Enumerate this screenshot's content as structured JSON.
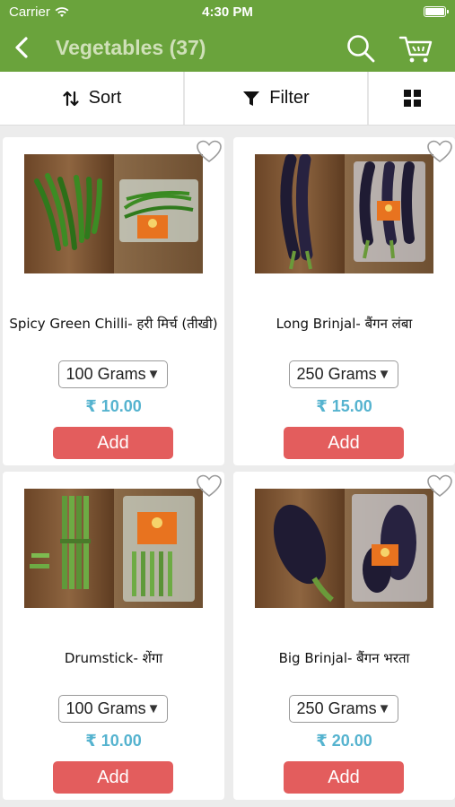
{
  "status_bar": {
    "carrier": "Carrier",
    "time": "4:30 PM"
  },
  "nav": {
    "title": "Vegetables (37)",
    "back_icon": "chevron-left-icon",
    "search_icon": "search-icon",
    "cart_icon": "cart-icon"
  },
  "toolbar": {
    "sort_label": "Sort",
    "filter_label": "Filter"
  },
  "products": [
    {
      "name": "Spicy Green Chilli- हरी मिर्च (तीखी)",
      "quantity": "100 Grams",
      "price": "₹ 10.00",
      "add_label": "Add"
    },
    {
      "name": "Long Brinjal- बैंगन लंबा",
      "quantity": "250 Grams",
      "price": "₹ 15.00",
      "add_label": "Add"
    },
    {
      "name": "Drumstick- शेंगा",
      "quantity": "100 Grams",
      "price": "₹ 10.00",
      "add_label": "Add"
    },
    {
      "name": "Big Brinjal- बैंगन  भरता",
      "quantity": "250 Grams",
      "price": "₹ 20.00",
      "add_label": "Add"
    }
  ],
  "colors": {
    "header": "#6aa33c",
    "price": "#55b3cf",
    "add_button": "#e35d5d"
  }
}
